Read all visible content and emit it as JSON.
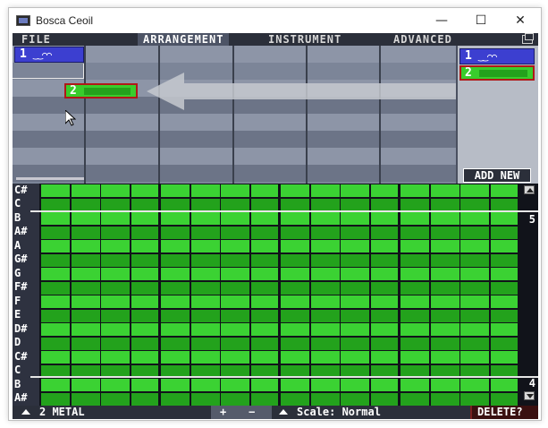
{
  "window": {
    "title": "Bosca Ceoil",
    "minimize": "—",
    "maximize": "☐",
    "close": "✕"
  },
  "menu": {
    "items": [
      {
        "label": "FILE",
        "active": false
      },
      {
        "label": "ARRANGEMENT",
        "active": true
      },
      {
        "label": "INSTRUMENT",
        "active": false
      },
      {
        "label": "ADVANCED",
        "active": false
      }
    ]
  },
  "arrangement": {
    "placed_blue_pattern_number": "1",
    "placed_blue_pattern_notes": "‿‿⌒⌒",
    "dragging_pattern_number": "2"
  },
  "pattern_list": {
    "patterns": [
      {
        "number": "1",
        "notes": "‿‿⌒⌒",
        "color": "#3c3fd0"
      },
      {
        "number": "2",
        "notes": "",
        "color": "#39cc2c"
      }
    ],
    "add_new_label": "ADD NEW"
  },
  "piano_roll": {
    "keys": [
      "C#",
      "C",
      "B",
      "A#",
      "A",
      "G#",
      "G",
      "F#",
      "F",
      "E",
      "D#",
      "D",
      "C#",
      "C",
      "B",
      "A#"
    ],
    "octave_top": "5",
    "octave_bottom": "4",
    "columns": 16
  },
  "bottom_bar": {
    "instrument_label": "2 METAL",
    "plus_label": "+",
    "minus_label": "−",
    "scale_label": "Scale: Normal",
    "delete_label": "DELETE?"
  },
  "colors": {
    "note_light": "#3bd233",
    "note_dark": "#23a21c",
    "arrangement_bg": "#7c8598",
    "arrangement_row_dark": "#6c7487",
    "menu_bg": "#2b2f3a"
  }
}
